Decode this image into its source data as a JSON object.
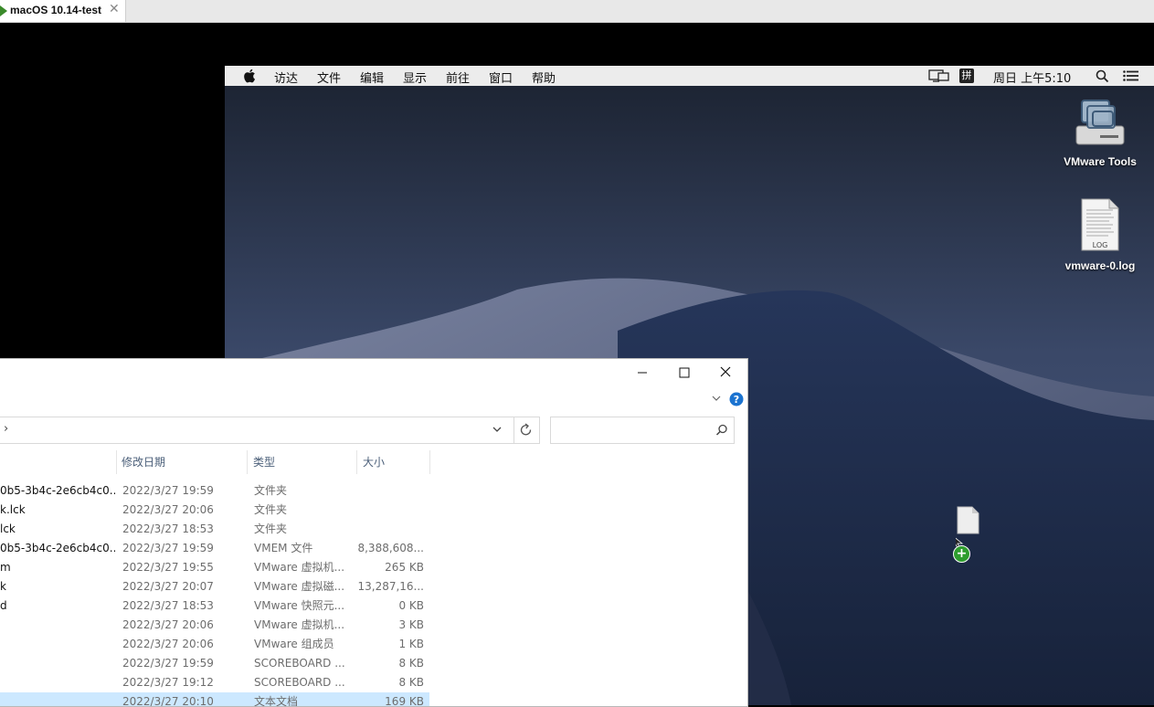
{
  "vmware": {
    "tab_title": "macOS 10.14-test",
    "close_glyph": "✕"
  },
  "mac": {
    "menu": [
      "访达",
      "文件",
      "编辑",
      "显示",
      "前往",
      "窗口",
      "帮助"
    ],
    "input_method": "拼",
    "clock": "周日 上午5:10",
    "desktop_items": [
      {
        "label": "VMware Tools",
        "icon": "disk-image-icon"
      },
      {
        "label": "vmware-0.log",
        "icon": "log-file-icon",
        "badge": "LOG"
      }
    ],
    "drag_badge": "+"
  },
  "explorer": {
    "address_chevron": "›",
    "columns": [
      "修改日期",
      "类型",
      "大小"
    ],
    "rows": [
      {
        "name": "0b5-3b4c-2e6cb4c0...",
        "date": "2022/3/27 19:59",
        "type": "文件夹",
        "size": ""
      },
      {
        "name": "k.lck",
        "date": "2022/3/27 20:06",
        "type": "文件夹",
        "size": ""
      },
      {
        "name": "lck",
        "date": "2022/3/27 18:53",
        "type": "文件夹",
        "size": ""
      },
      {
        "name": "0b5-3b4c-2e6cb4c0...",
        "date": "2022/3/27 19:59",
        "type": "VMEM 文件",
        "size": "8,388,608..."
      },
      {
        "name": "m",
        "date": "2022/3/27 19:55",
        "type": "VMware 虚拟机...",
        "size": "265 KB"
      },
      {
        "name": "k",
        "date": "2022/3/27 20:07",
        "type": "VMware 虚拟磁...",
        "size": "13,287,16..."
      },
      {
        "name": "d",
        "date": "2022/3/27 18:53",
        "type": "VMware 快照元...",
        "size": "0 KB"
      },
      {
        "name": "",
        "date": "2022/3/27 20:06",
        "type": "VMware 虚拟机...",
        "size": "3 KB"
      },
      {
        "name": "",
        "date": "2022/3/27 20:06",
        "type": "VMware 组成员",
        "size": "1 KB"
      },
      {
        "name": "",
        "date": "2022/3/27 19:59",
        "type": "SCOREBOARD ...",
        "size": "8 KB"
      },
      {
        "name": "",
        "date": "2022/3/27 19:12",
        "type": "SCOREBOARD ...",
        "size": "8 KB"
      },
      {
        "name": "",
        "date": "2022/3/27 20:10",
        "type": "文本文档",
        "size": "169 KB",
        "selected": true
      }
    ]
  }
}
